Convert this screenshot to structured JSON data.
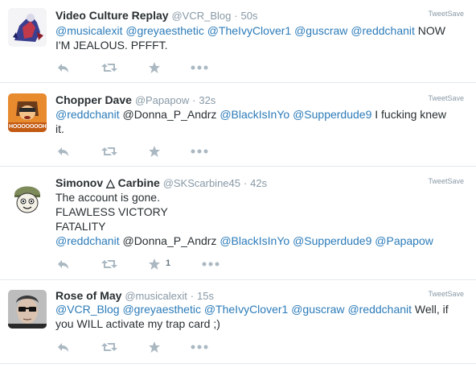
{
  "tweets": [
    {
      "avatar": "anime-robot-avatar",
      "name": "Video Culture Replay",
      "handle": "@VCR_Blog",
      "time": "50s",
      "source": "TweetSave",
      "parts": [
        "@musicalexit",
        " ",
        "@greyaesthetic",
        " ",
        "@TheIvyClover1",
        " ",
        "@guscraw",
        " ",
        "@reddchanit",
        " NOW\nI'M JEALOUS. PFFFT."
      ],
      "like_count": ""
    },
    {
      "avatar": "cartoon-character-avatar",
      "avatar_caption": "HOOOOOOOH",
      "name": "Chopper Dave",
      "handle": "@Papapow",
      "time": "32s",
      "source": "TweetSave",
      "parts": [
        "@reddchanit",
        " @Donna_P_Andrz ",
        "@BlackIsInYo",
        " ",
        "@Supperdude9",
        " I fucking knew\nit."
      ],
      "like_count": ""
    },
    {
      "avatar": "soldier-cartoon-avatar",
      "name": "Simonov △ Carbine",
      "handle": "@SKScarbine45",
      "time": "42s",
      "source": "TweetSave",
      "parts": [
        "The account is gone.\nFLAWLESS VICTORY\nFATALITY\n",
        "@reddchanit",
        " @Donna_P_Andrz ",
        "@BlackIsInYo",
        " ",
        "@Supperdude9",
        " ",
        "@Papapow"
      ],
      "like_count": "1"
    },
    {
      "avatar": "man-glasses-photo-avatar",
      "name": "Rose of May",
      "handle": "@musicalexit",
      "time": "15s",
      "source": "TweetSave",
      "parts": [
        "@VCR_Blog",
        " ",
        "@greyaesthetic",
        " ",
        "@TheIvyClover1",
        " ",
        "@guscraw",
        " ",
        "@reddchanit",
        " Well, if\nyou WILL activate my trap card ;)"
      ],
      "like_count": ""
    }
  ],
  "dot": "·",
  "colors": {
    "mention": "#2b7bb9",
    "text": "#292f33",
    "muted": "#8899a6",
    "icon": "#aab8c2",
    "border": "#e1e8ed"
  }
}
